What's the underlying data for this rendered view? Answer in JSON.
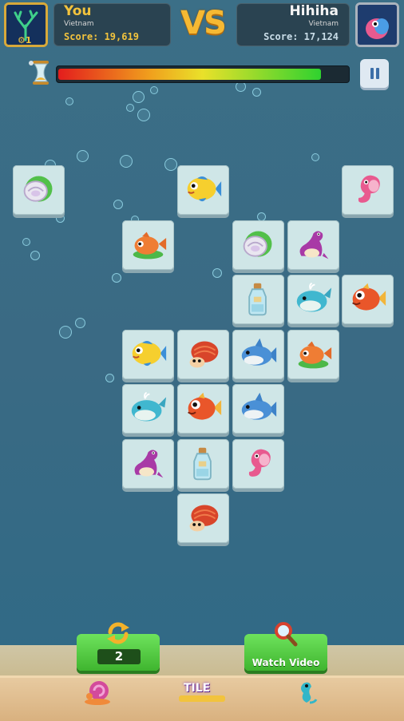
{
  "player": {
    "name": "You",
    "country": "Vietnam",
    "score": "Score: 19,619",
    "badge": "1"
  },
  "opponent": {
    "name": "Hihiha",
    "country": "Vietnam",
    "score": "Score: 17,124"
  },
  "vs_label": "VS",
  "timer": {
    "fill_fraction": 0.91
  },
  "buttons": {
    "shuffle_count": "2",
    "watch_video": "Watch Video"
  },
  "dock": {
    "logo_text": "TILE"
  },
  "board": {
    "tiles": [
      {
        "kind": "shell",
        "row": 0,
        "col": 0
      },
      {
        "kind": "yellowfish",
        "row": 0,
        "col": 3
      },
      {
        "kind": "seahorse",
        "row": 0,
        "col": 6
      },
      {
        "kind": "goldfish-green",
        "row": 1,
        "col": 2
      },
      {
        "kind": "shell",
        "row": 1,
        "col": 4
      },
      {
        "kind": "seal",
        "row": 1,
        "col": 5
      },
      {
        "kind": "bottle",
        "row": 2,
        "col": 4
      },
      {
        "kind": "whale",
        "row": 2,
        "col": 5
      },
      {
        "kind": "redfish",
        "row": 2,
        "col": 6
      },
      {
        "kind": "yellowfish",
        "row": 3,
        "col": 2
      },
      {
        "kind": "hermit",
        "row": 3,
        "col": 3
      },
      {
        "kind": "shark",
        "row": 3,
        "col": 4
      },
      {
        "kind": "goldfish-green",
        "row": 3,
        "col": 5
      },
      {
        "kind": "whale",
        "row": 4,
        "col": 2
      },
      {
        "kind": "redfish",
        "row": 4,
        "col": 3
      },
      {
        "kind": "shark",
        "row": 4,
        "col": 4
      },
      {
        "kind": "seal",
        "row": 5,
        "col": 2
      },
      {
        "kind": "bottle",
        "row": 5,
        "col": 3
      },
      {
        "kind": "seahorse",
        "row": 5,
        "col": 4
      },
      {
        "kind": "hermit",
        "row": 6,
        "col": 3
      }
    ]
  },
  "colors": {
    "score": "#f2c33d",
    "timer_bg": "#1b2a33",
    "button_green": "#4fc63e"
  }
}
